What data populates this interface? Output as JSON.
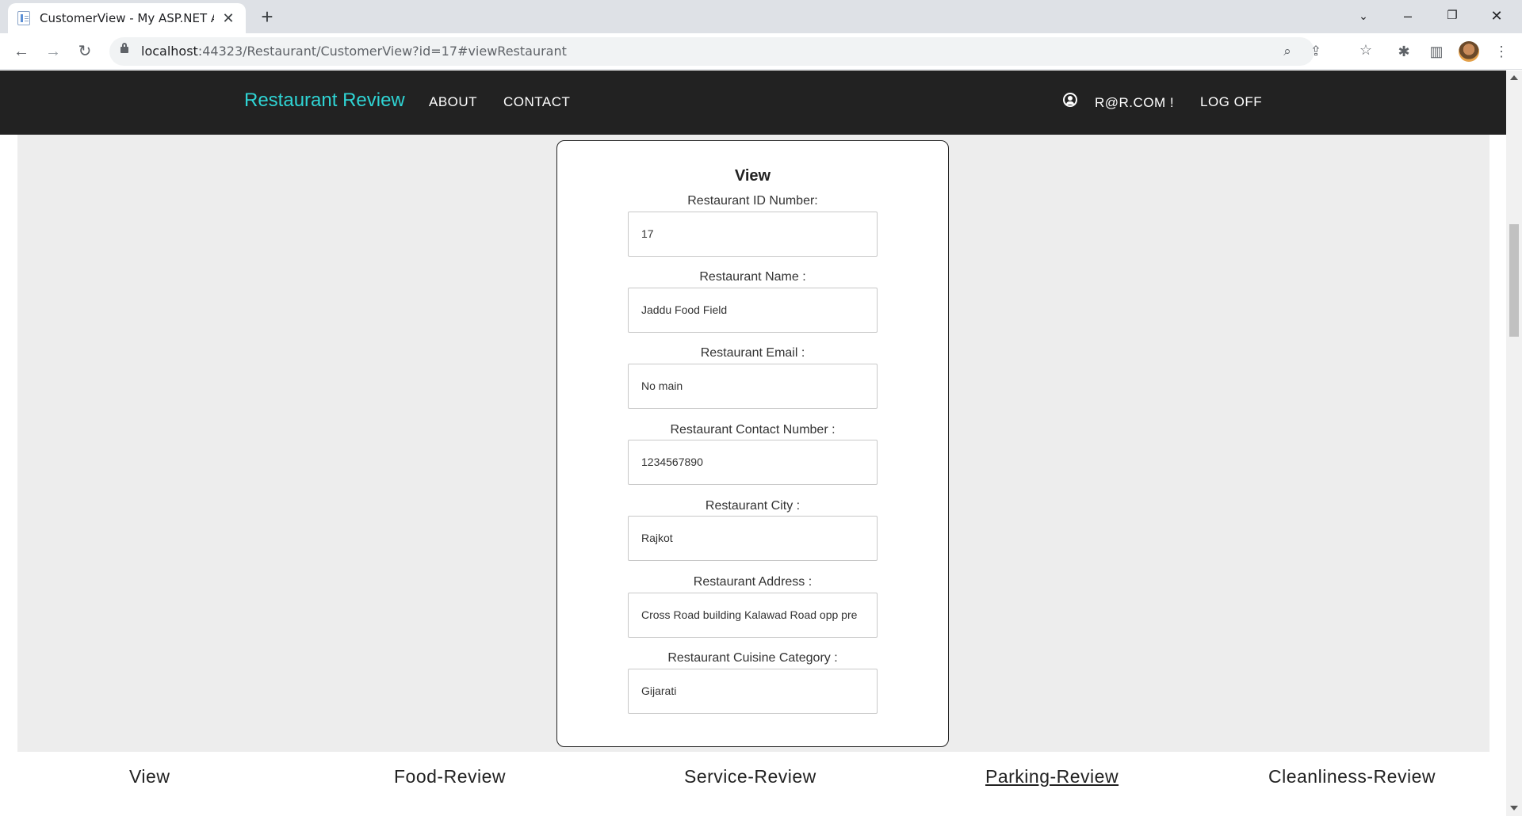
{
  "browser": {
    "tab_title": "CustomerView - My ASP.NET Ap",
    "url_host": "localhost",
    "url_rest": ":44323/Restaurant/CustomerView?id=17#viewRestaurant"
  },
  "site": {
    "brand": "Restaurant Review",
    "nav": {
      "about": "ABOUT",
      "contact": "CONTACT"
    },
    "user": "R@R.COM !",
    "logoff": "LOG OFF"
  },
  "card": {
    "title": "View",
    "fields": [
      {
        "label": "Restaurant ID Number:",
        "value": "17"
      },
      {
        "label": "Restaurant Name :",
        "value": "Jaddu Food Field"
      },
      {
        "label": "Restaurant Email :",
        "value": "No main"
      },
      {
        "label": "Restaurant Contact Number :",
        "value": "1234567890"
      },
      {
        "label": "Restaurant City :",
        "value": "Rajkot"
      },
      {
        "label": "Restaurant Address :",
        "value": "Cross Road building Kalawad Road opp pre"
      },
      {
        "label": "Restaurant Cuisine Category :",
        "value": "Gijarati"
      }
    ]
  },
  "bottom_tabs": [
    {
      "label": "View"
    },
    {
      "label": "Food-Review"
    },
    {
      "label": "Service-Review"
    },
    {
      "label": "Parking-Review"
    },
    {
      "label": "Cleanliness-Review"
    }
  ],
  "colors": {
    "brand": "#2fd4d4",
    "navbar": "#222222",
    "page_bg": "#ededed"
  }
}
